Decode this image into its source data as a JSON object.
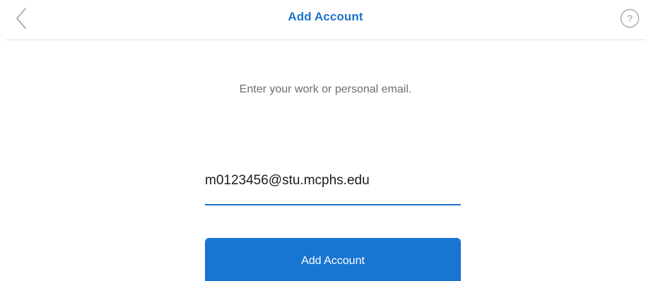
{
  "header": {
    "title": "Add Account",
    "back_icon": "chevron-left-icon",
    "help_icon": "question-circle-icon"
  },
  "form": {
    "prompt": "Enter your work or personal email.",
    "email_value": "m0123456@stu.mcphs.edu",
    "submit_label": "Add Account"
  },
  "colors": {
    "accent": "#1f73c8",
    "button": "#1875d2",
    "prompt_text": "#6e6e73",
    "icon_gray": "#9a9aa0"
  }
}
